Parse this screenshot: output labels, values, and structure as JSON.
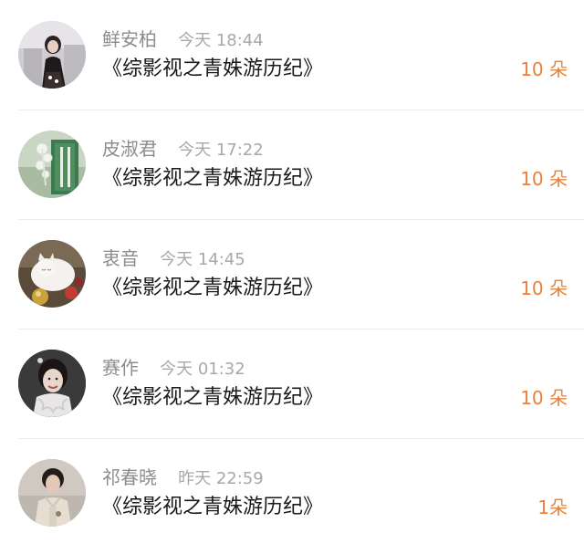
{
  "accent_color": "#e9823a",
  "items": [
    {
      "name": "鲜安柏",
      "time": "今天 18:44",
      "title": "《综影视之青姝游历纪》",
      "amount": "10 朵"
    },
    {
      "name": "皮淑君",
      "time": "今天 17:22",
      "title": "《综影视之青姝游历纪》",
      "amount": "10 朵"
    },
    {
      "name": "衷音",
      "time": "今天 14:45",
      "title": "《综影视之青姝游历纪》",
      "amount": "10 朵"
    },
    {
      "name": "赛作",
      "time": "今天 01:32",
      "title": "《综影视之青姝游历纪》",
      "amount": "10 朵"
    },
    {
      "name": "祁春晓",
      "time": "昨天 22:59",
      "title": "《综影视之青姝游历纪》",
      "amount": "1朵"
    }
  ]
}
